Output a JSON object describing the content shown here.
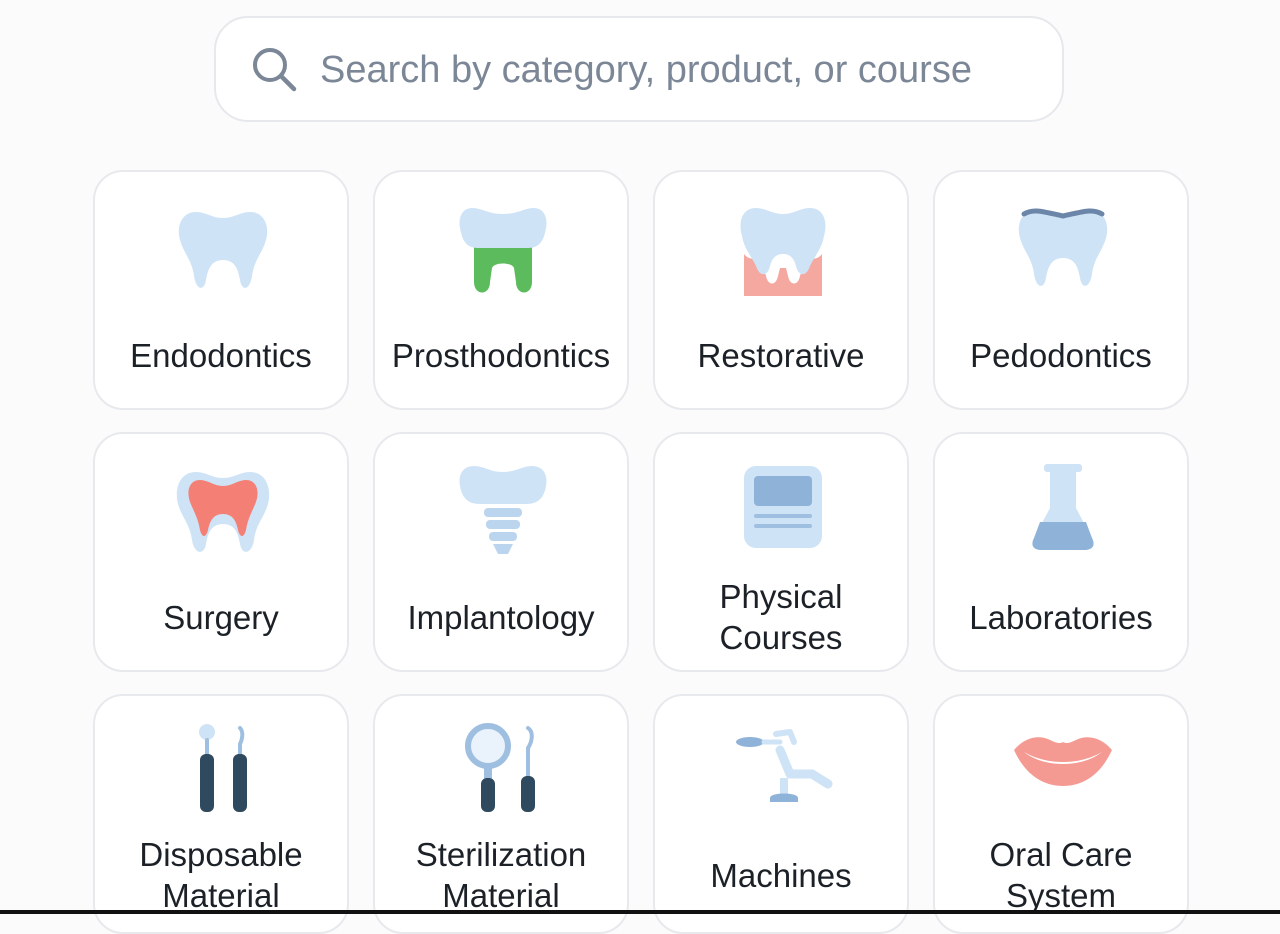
{
  "search": {
    "placeholder": "Search by category, product, or course",
    "icon": "search-icon"
  },
  "categories": [
    {
      "label": "Endodontics",
      "icon": "tooth-icon"
    },
    {
      "label": "Prosthodontics",
      "icon": "crown-bridge-icon"
    },
    {
      "label": "Restorative",
      "icon": "restored-tooth-icon"
    },
    {
      "label": "Pedodontics",
      "icon": "child-tooth-icon"
    },
    {
      "label": "Surgery",
      "icon": "tooth-pulp-icon"
    },
    {
      "label": "Implantology",
      "icon": "dental-implant-icon"
    },
    {
      "label": "Physical\nCourses",
      "icon": "course-document-icon"
    },
    {
      "label": "Laboratories",
      "icon": "flask-icon"
    },
    {
      "label": "Disposable\nMaterial",
      "icon": "dental-probes-icon"
    },
    {
      "label": "Sterilization\nMaterial",
      "icon": "mirror-probe-icon"
    },
    {
      "label": "Machines",
      "icon": "dental-chair-icon"
    },
    {
      "label": "Oral Care\nSystem",
      "icon": "lips-icon"
    }
  ],
  "colors": {
    "tooth": "#cfe3f7",
    "gum_green": "#5cbb5c",
    "gum_pink": "#f4a8a0",
    "pulp_red": "#f47f74",
    "instrument_dark": "#2f4a5e",
    "lips": "#f49a93"
  }
}
